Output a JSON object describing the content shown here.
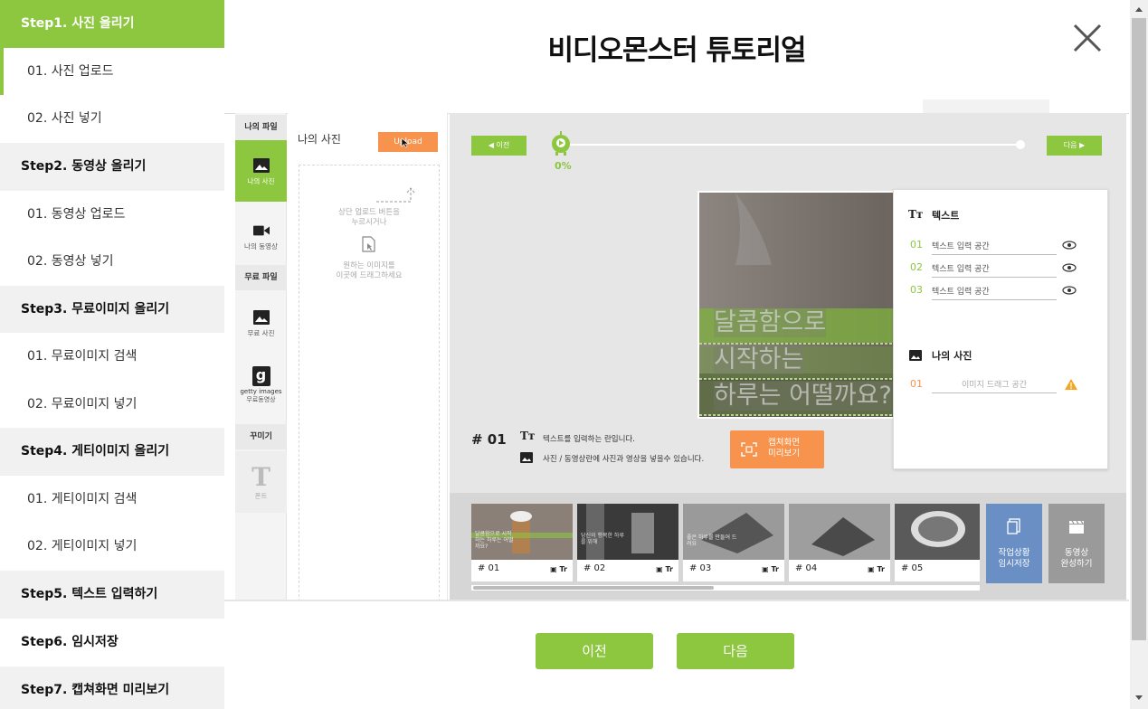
{
  "title": "비디오몬스터 튜토리얼",
  "sidebar": {
    "steps": [
      {
        "label": "Step1. 사진 올리기",
        "subs": [
          "01. 사진 업로드",
          "02. 사진 넣기"
        ]
      },
      {
        "label": "Step2. 동영상 올리기",
        "subs": [
          "01. 동영상 업로드",
          "02. 동영상 넣기"
        ]
      },
      {
        "label": "Step3. 무료이미지 올리기",
        "subs": [
          "01. 무료이미지 검색",
          "02. 무료이미지 넣기"
        ]
      },
      {
        "label": "Step4. 게티이미지 올리기",
        "subs": [
          "01. 게티이미지 검색",
          "02. 게티이미지 넣기"
        ]
      },
      {
        "label": "Step5. 텍스트 입력하기",
        "subs": []
      },
      {
        "label": "Step6. 임시저장",
        "subs": []
      },
      {
        "label": "Step7. 캡쳐화면 미리보기",
        "subs": []
      }
    ]
  },
  "app": {
    "tabs": {
      "my_files_head": "나의 파일",
      "my_photo": "나의 사진",
      "my_video": "나의 동영상",
      "free_head": "무료 파일",
      "free_photo": "무료 사진",
      "getty_label": "getty images",
      "free_video": "무료동영상",
      "deco_head": "꾸미기",
      "font": "폰트"
    },
    "photo_panel": {
      "title": "나의 사진",
      "upload_button": "Upload",
      "hint1a": "상단 업로드 버튼을",
      "hint1b": "누르시거나",
      "hint2a": "원하는 이미지를",
      "hint2b": "이곳에 드래그하세요"
    },
    "timeline": {
      "prev": "◀ 이전",
      "next": "다음 ▶",
      "progress_label": "0%",
      "progress": 0
    },
    "stage": {
      "line1": "달콤함으로",
      "line2": "시작하는",
      "line3": "하루는 어떨까요?",
      "markers": [
        "1",
        "1",
        "2",
        "3"
      ]
    },
    "scene": {
      "number": "# 01",
      "text_hint": "텍스트를 입력하는 란입니다.",
      "media_hint": "사진 / 동영상란에 사진과 영상을 넣을수 있습니다.",
      "capture_button_l1": "캡쳐화면",
      "capture_button_l2": "미리보기"
    },
    "text_panel": {
      "text_header": "텍스트",
      "rows": [
        {
          "num": "01",
          "placeholder": "텍스트 입력 공간"
        },
        {
          "num": "02",
          "placeholder": "텍스트 입력 공간"
        },
        {
          "num": "03",
          "placeholder": "텍스트 입력 공간"
        }
      ],
      "photo_header": "나의 사진",
      "photo_row": {
        "num": "01",
        "placeholder": "이미지 드래그 공간"
      }
    },
    "thumbs": [
      {
        "num": "# 01",
        "caption": "달콤함으로 시작하는 하루는 어떨까요?"
      },
      {
        "num": "# 02",
        "caption": "당신의 행복한 하루를 위해"
      },
      {
        "num": "# 03",
        "caption": "좋은 하루를 만들어 드려요"
      },
      {
        "num": "# 04",
        "caption": ""
      },
      {
        "num": "# 05",
        "caption": ""
      }
    ],
    "thumb_icons": "▣ Tr",
    "save_button_l1": "작업상황",
    "save_button_l2": "임시저장",
    "finish_button_l1": "동영상",
    "finish_button_l2": "완성하기"
  },
  "nav": {
    "prev": "이전",
    "next": "다음"
  },
  "colors": {
    "accent": "#8dc63f",
    "orange": "#f7934c",
    "blue": "#6a8fc4",
    "gray": "#9a9a9a"
  }
}
